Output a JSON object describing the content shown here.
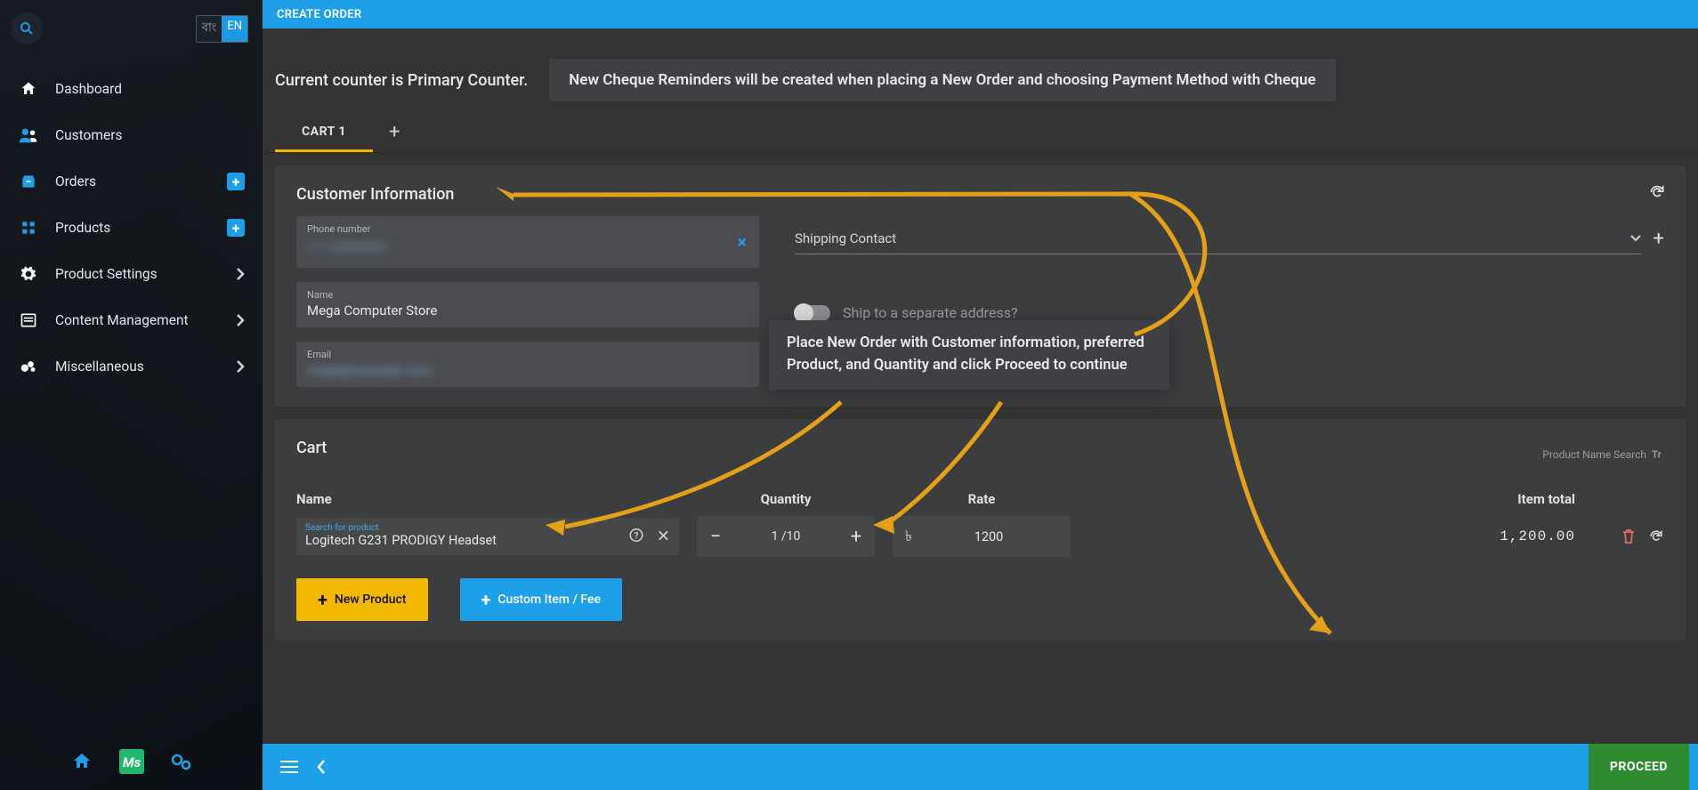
{
  "topbar": {
    "title": "CREATE ORDER"
  },
  "lang": {
    "inactive": "বাং",
    "active": "EN"
  },
  "sidebar": {
    "items": [
      {
        "label": "Dashboard"
      },
      {
        "label": "Customers"
      },
      {
        "label": "Orders"
      },
      {
        "label": "Products"
      },
      {
        "label": "Product Settings"
      },
      {
        "label": "Content Management"
      },
      {
        "label": "Miscellaneous"
      }
    ]
  },
  "counter_text": "Current counter is Primary Counter.",
  "banner1": "New Cheque Reminders will be created when placing a New Order and choosing Payment Method with Cheque",
  "tabs": {
    "tab1": "CART 1"
  },
  "customer": {
    "title": "Customer Information",
    "phone_label": "Phone number",
    "phone_value": "০১৭xxxxxxxx",
    "name_label": "Name",
    "name_value": "Mega Computer Store",
    "email_label": "Email",
    "email_value": "mega@example.com",
    "shipping_label": "Shipping Contact",
    "ship_toggle_label": "Ship to a separate address?"
  },
  "annotate": {
    "text": "Place New Order with Customer information, preferred Product, and Quantity and click Proceed to continue"
  },
  "cart": {
    "title": "Cart",
    "pns": "Product Name Search",
    "cols": {
      "name": "Name",
      "qty": "Quantity",
      "rate": "Rate",
      "itotal": "Item total"
    },
    "search_label": "Search for product",
    "search_value": "Logitech G231 PRODIGY Headset",
    "qty": "1 /10",
    "rate": "1200",
    "item_total": "1,200.00",
    "new_product": "New Product",
    "custom_item": "Custom Item / Fee"
  },
  "footer": {
    "proceed": "PROCEED"
  }
}
